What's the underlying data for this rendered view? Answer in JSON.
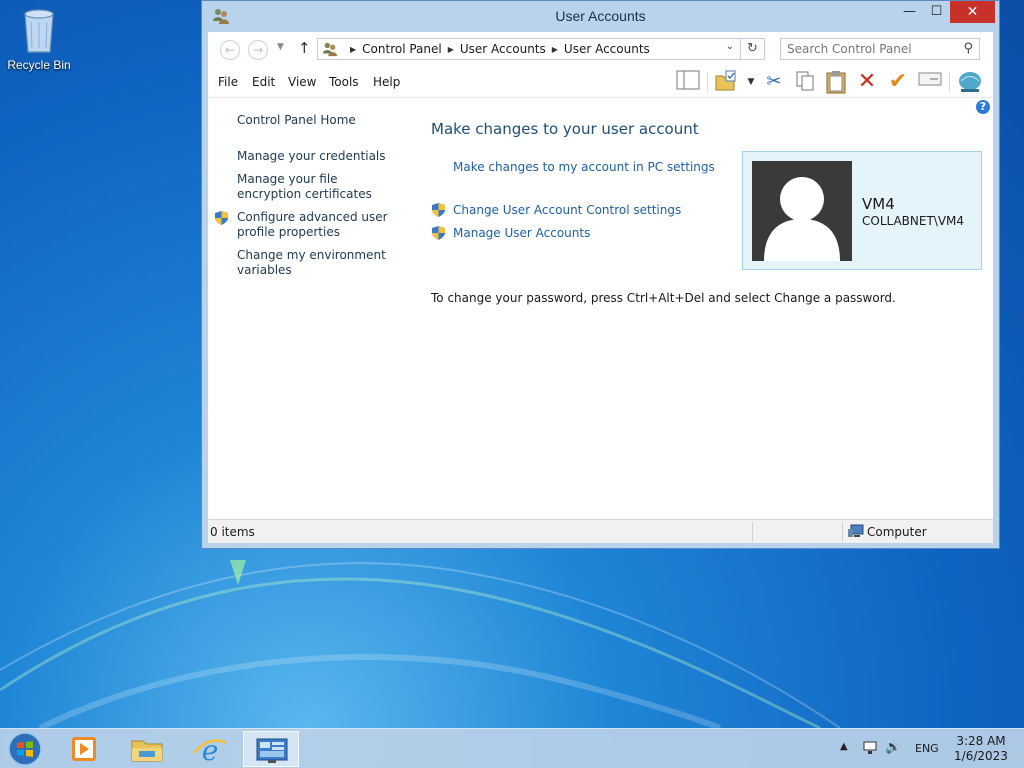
{
  "desktop": {
    "recycle_bin_label": "Recycle Bin"
  },
  "window": {
    "title": "User Accounts",
    "controls": {
      "minimize": "—",
      "maximize": "☐",
      "close": "✕"
    }
  },
  "address_bar": {
    "breadcrumbs": [
      "Control Panel",
      "User Accounts",
      "User Accounts"
    ],
    "search_placeholder": "Search Control Panel"
  },
  "menu": [
    "File",
    "Edit",
    "View",
    "Tools",
    "Help"
  ],
  "toolbar_icons": [
    "layout-icon",
    "folder-options-icon",
    "cut-icon",
    "copy-icon",
    "paste-icon",
    "delete-icon",
    "checkmark-icon",
    "properties-icon",
    "network-icon"
  ],
  "sidebar": {
    "home": "Control Panel Home",
    "links": [
      "Manage your credentials",
      "Manage your file encryption certificates",
      "Configure advanced user profile properties",
      "Change my environment variables"
    ]
  },
  "main": {
    "title": "Make changes to your user account",
    "pc_settings_link": "Make changes to my account in PC settings",
    "uac_link": "Change User Account Control settings",
    "manage_link": "Manage User Accounts",
    "password_note": "To change your password, press Ctrl+Alt+Del and select Change a password."
  },
  "account": {
    "name": "VM4",
    "domain": "COLLABNET\\VM4"
  },
  "statusbar": {
    "items": "0 items",
    "zone": "Computer"
  },
  "taskbar": {
    "language": "ENG",
    "time": "3:28 AM",
    "date": "1/6/2023"
  },
  "colors": {
    "link": "#1e5fa8",
    "title": "#1e4e79",
    "close_button": "#c7312a",
    "account_card": "#e5f3fb"
  }
}
